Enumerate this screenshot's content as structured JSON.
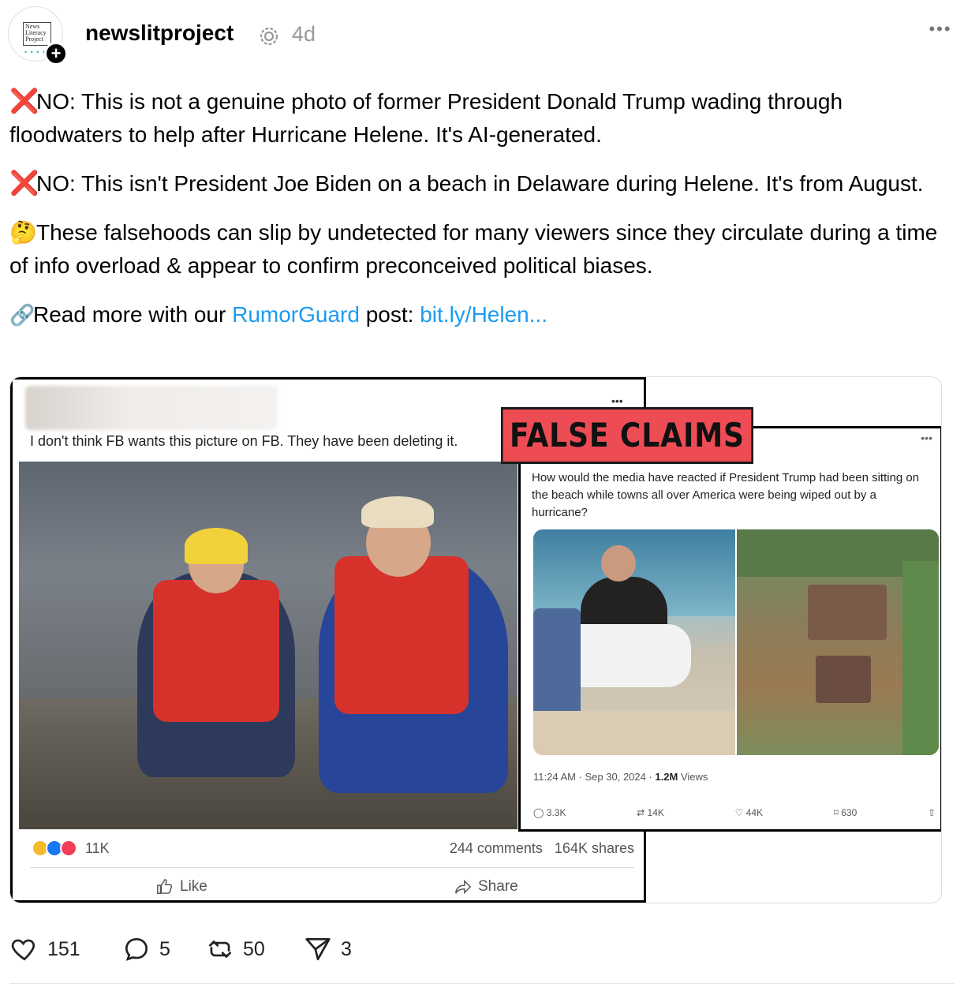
{
  "post": {
    "username": "newslitproject",
    "time": "4d",
    "avatar_text": "News Literacy Project",
    "paragraphs": [
      {
        "prefix": "❌",
        "text": "NO: This is not a genuine photo of former President Donald Trump wading through floodwaters to help after Hurricane Helene. It's AI-generated."
      },
      {
        "prefix": "❌",
        "text": "NO: This isn't President Joe Biden on a beach in Delaware during Helene. It's from August."
      },
      {
        "prefix": "🤔",
        "text": "These falsehoods can slip by undetected for many viewers since they circulate during a time of info overload & appear to confirm preconceived political biases."
      }
    ],
    "link_line": {
      "prefix": "🔗",
      "before": "Read more with our ",
      "mention": "RumorGuard",
      "middle": " post: ",
      "url": "bit.ly/Helen..."
    }
  },
  "media": {
    "fb": {
      "caption": "I don't think FB wants this picture on FB. They have been deleting it.",
      "reactions": "11K",
      "comments": "244 comments",
      "shares": "164K shares",
      "like_label": "Like",
      "share_label": "Share"
    },
    "banner": "FALSE CLAIMS",
    "x": {
      "text": "How would the media have reacted if President Trump had been sitting on the beach while towns all over America were being wiped out by a hurricane?",
      "timestamp": "11:24 AM · Sep 30, 2024 · ",
      "views_value": "1.2M",
      "views_label": " Views",
      "replies": "3.3K",
      "reposts": "14K",
      "likes": "44K",
      "bookmarks": "630"
    }
  },
  "actions": {
    "likes": "151",
    "replies": "5",
    "reposts": "50",
    "shares": "3"
  },
  "colors": {
    "link": "#1a9bf0",
    "x_mark": "#e0221d",
    "banner": "#ee4c55"
  }
}
